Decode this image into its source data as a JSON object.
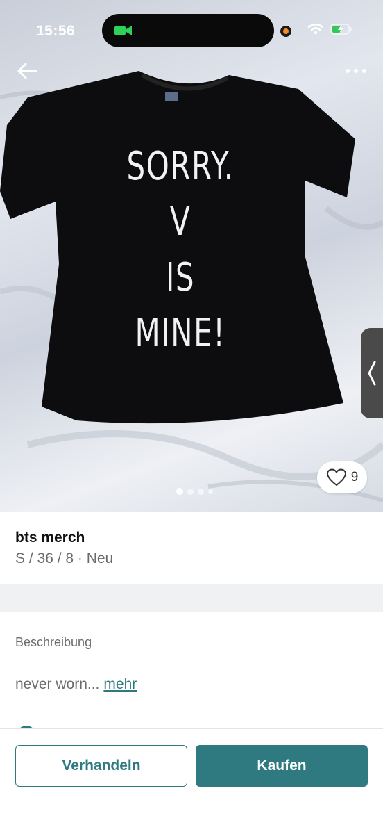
{
  "status_bar": {
    "time": "15:56",
    "icons": [
      "facetime-video-icon",
      "recording-dot-icon",
      "wifi-icon",
      "battery-charging-icon"
    ]
  },
  "header": {
    "back_icon": "arrow-left-icon",
    "more_icon": "more-horizontal-icon"
  },
  "photo": {
    "shirt_print": [
      "SORRY.",
      "V",
      "IS MINE!"
    ],
    "like_count": "9",
    "carousel_total": 4,
    "carousel_active": 1
  },
  "item": {
    "title": "bts merch",
    "details": "S / 36 / 8 · Neu"
  },
  "description": {
    "label": "Beschreibung",
    "text": "never worn...",
    "more_link": "mehr"
  },
  "actions": {
    "negotiate_label": "Verhandeln",
    "buy_label": "Kaufen"
  },
  "colors": {
    "accent": "#2f7a80",
    "text_muted": "#6b6b6b",
    "separator": "#eff1f3"
  }
}
